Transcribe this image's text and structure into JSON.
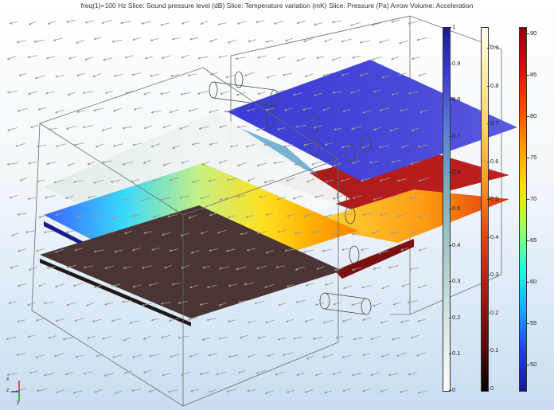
{
  "title": "freq(1)=100 Hz   Slice: Sound pressure level (dB)  Slice: Temperature variation (mK)  Slice: Pressure (Pa)  Arrow Volume: Acceleration",
  "colorbars": [
    {
      "ticks": [
        "1",
        "0.9",
        "0.8",
        "0.7",
        "0.6",
        "0.5",
        "0.4",
        "0.3",
        "0.2",
        "0.1",
        "0"
      ]
    },
    {
      "ticks": [
        "0.9",
        "0.8",
        "0.7",
        "0.6",
        "0.5",
        "0.4",
        "0.3",
        "0.2",
        "0.1",
        "0"
      ]
    },
    {
      "ticks": [
        "90",
        "85",
        "80",
        "75",
        "70",
        "65",
        "60",
        "55",
        "50"
      ]
    }
  ],
  "axes": {
    "x": "x",
    "y": "y",
    "z": "z"
  },
  "colors": {
    "bar1_top": "#1a1a8c",
    "bar2_top": "#fffff0",
    "bar3_top": "#8b0000"
  }
}
